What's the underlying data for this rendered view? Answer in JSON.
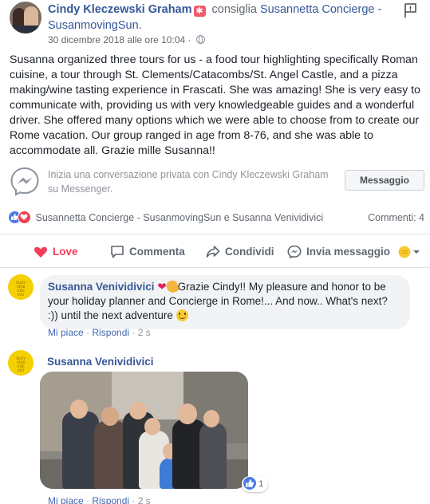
{
  "post": {
    "author": "Cindy Kleczewski Graham",
    "verb": "consiglia",
    "page": "Susannetta Concierge - SusanmovingSun.",
    "timestamp": "30 dicembre 2018 alle ore 10:04 ·",
    "body": "Susanna organized three tours for us - a food tour highlighting specifically Roman cuisine, a tour through St. Clements/Catacombs/St. Angel Castle, and a pizza making/wine tasting experience in Frascati. She was amazing! She is very easy to communicate with, providing us with very knowledgeable guides and a wonderful driver. She offered many options which we were able to choose from to create our Rome vacation. Our group ranged in age from 8-76, and she was able to accommodate all. Grazie mille Susanna!!",
    "badge_icon": "recommend-icon",
    "flag_icon": "report-flag-icon"
  },
  "messenger": {
    "text": "Inizia una conversazione privata con Cindy Kleczewski Graham su Messenger.",
    "button": "Messaggio"
  },
  "reactions": {
    "names": "Susannetta Concierge - SusanmovingSun e Susanna Venividivici",
    "comments": "Commenti: 4"
  },
  "actions": {
    "love": "Love",
    "comment": "Commenta",
    "share": "Condividi",
    "send": "Invia messaggio"
  },
  "comments": [
    {
      "author": "Susanna Venividivici",
      "text_a": "Grazie Cindy!! My pleasure and honor to be your holiday planner and Concierge in Rome!... And now.. What's next? :)) until the next adventure",
      "like": "Mi piace",
      "reply": "Rispondi",
      "time": "2 s"
    },
    {
      "author": "Susanna Venividivici",
      "like": "Mi piace",
      "reply": "Rispondi",
      "time": "2 s",
      "reaction_count": "1"
    }
  ],
  "avatar_text": "SUSY\nVENI\nVIDI\nVICI",
  "colors": {
    "link": "#365899",
    "love": "#f33e58",
    "like": "#4a7ae8",
    "bubble": "#f2f3f5"
  }
}
